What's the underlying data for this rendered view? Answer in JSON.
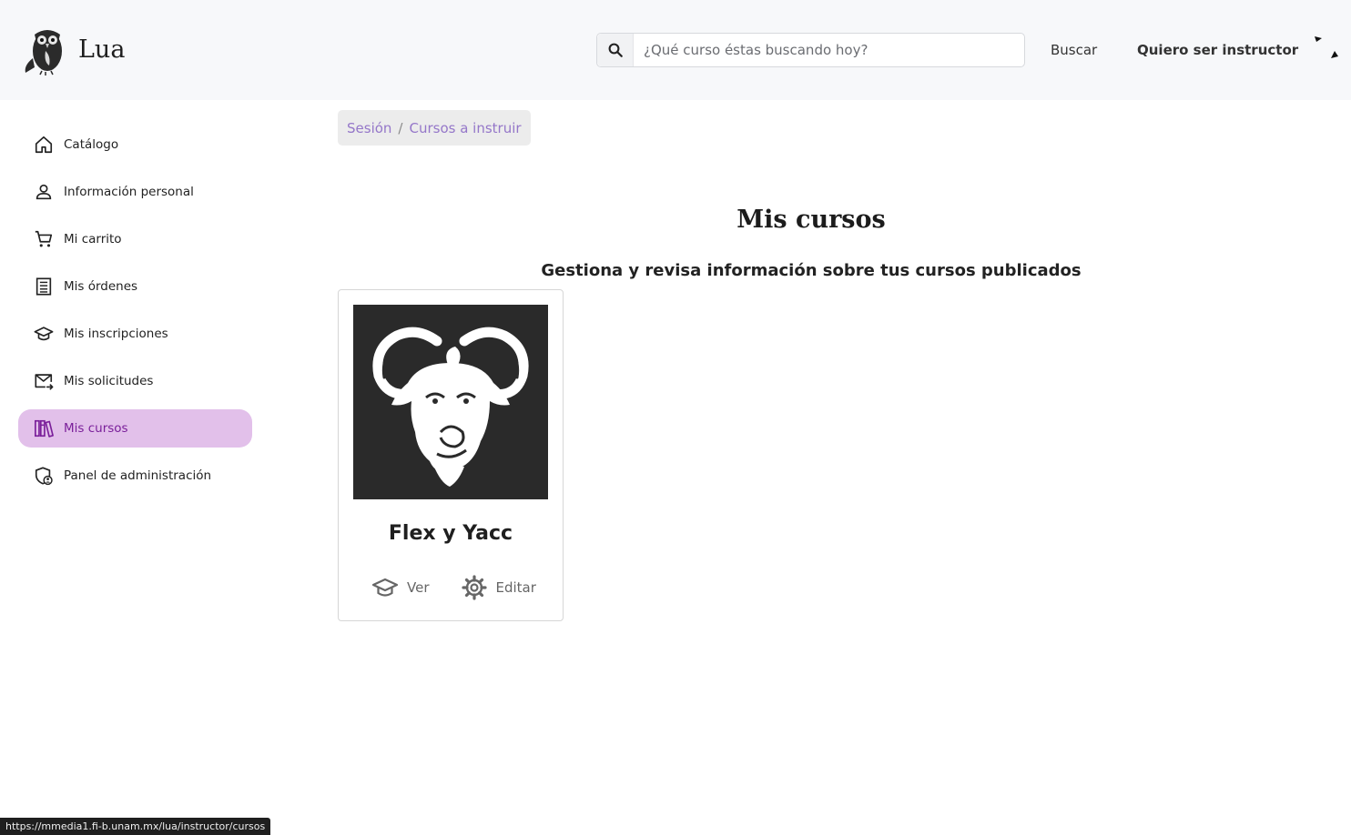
{
  "header": {
    "brand": "Lua",
    "search_placeholder": "¿Qué curso éstas buscando hoy?",
    "search_value": "",
    "buscar_label": "Buscar",
    "instructor_label": "Quiero ser instructor"
  },
  "sidebar": {
    "items": [
      {
        "label": "Catálogo",
        "icon": "home-icon"
      },
      {
        "label": "Información personal",
        "icon": "user-icon"
      },
      {
        "label": "Mi carrito",
        "icon": "cart-icon"
      },
      {
        "label": "Mis órdenes",
        "icon": "receipt-icon"
      },
      {
        "label": "Mis inscripciones",
        "icon": "graduation-cap-icon"
      },
      {
        "label": "Mis solicitudes",
        "icon": "mail-forward-icon"
      },
      {
        "label": "Mis cursos",
        "icon": "books-icon",
        "active": true
      },
      {
        "label": "Panel de administración",
        "icon": "shield-admin-icon"
      }
    ],
    "active_color": "#e2c0ea"
  },
  "breadcrumb": {
    "items": [
      "Sesión",
      "Cursos a instruir"
    ],
    "separator": "/"
  },
  "main": {
    "title": "Mis cursos",
    "subtitle": "Gestiona y revisa información sobre tus cursos publicados"
  },
  "courses": [
    {
      "title": "Flex y Yacc",
      "image_icon": "gnu-head-icon",
      "actions": {
        "view_label": "Ver",
        "edit_label": "Editar"
      }
    }
  ],
  "statusbar": {
    "url": "https://mmedia1.fi-b.unam.mx/lua/instructor/cursos"
  }
}
